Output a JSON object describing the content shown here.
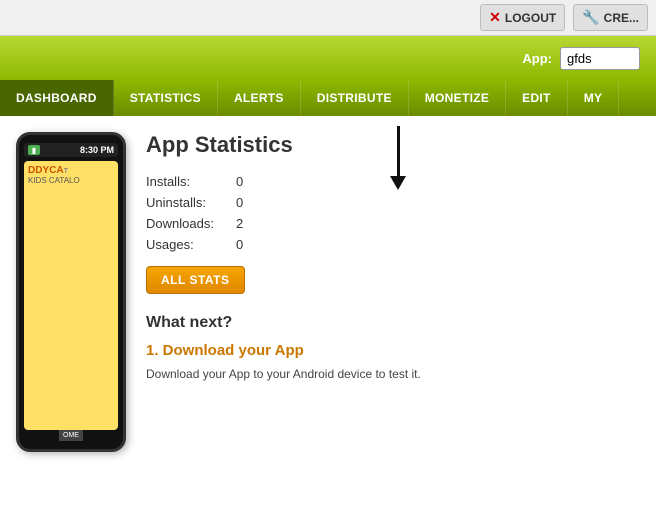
{
  "topbar": {
    "logout_label": "LOGOUT",
    "create_label": "CRE...",
    "logout_icon": "✕",
    "create_icon": "🔧"
  },
  "appbar": {
    "app_label": "App:",
    "app_value": "gfds"
  },
  "nav": {
    "items": [
      {
        "label": "DASHBOARD",
        "active": true
      },
      {
        "label": "STATISTICS",
        "active": false
      },
      {
        "label": "ALERTS",
        "active": false
      },
      {
        "label": "DISTRIBUTE",
        "active": false
      },
      {
        "label": "MONETIZE",
        "active": false
      },
      {
        "label": "EDIT",
        "active": false
      },
      {
        "label": "MY",
        "active": false
      }
    ]
  },
  "phone": {
    "signal": "▮",
    "time": "8:30 PM",
    "app_title": "DDYCA",
    "app_subtitle": "KIDS CATALO",
    "nav_label": "OME"
  },
  "stats": {
    "title": "App Statistics",
    "rows": [
      {
        "label": "Installs:",
        "value": "0"
      },
      {
        "label": "Uninstalls:",
        "value": "0"
      },
      {
        "label": "Downloads:",
        "value": "2"
      },
      {
        "label": "Usages:",
        "value": "0"
      }
    ],
    "all_stats_button": "ALL STATS"
  },
  "whatnext": {
    "title": "What next?",
    "section1_title": "1. Download your App",
    "section1_desc": "Download your App to your Android device to test it."
  }
}
